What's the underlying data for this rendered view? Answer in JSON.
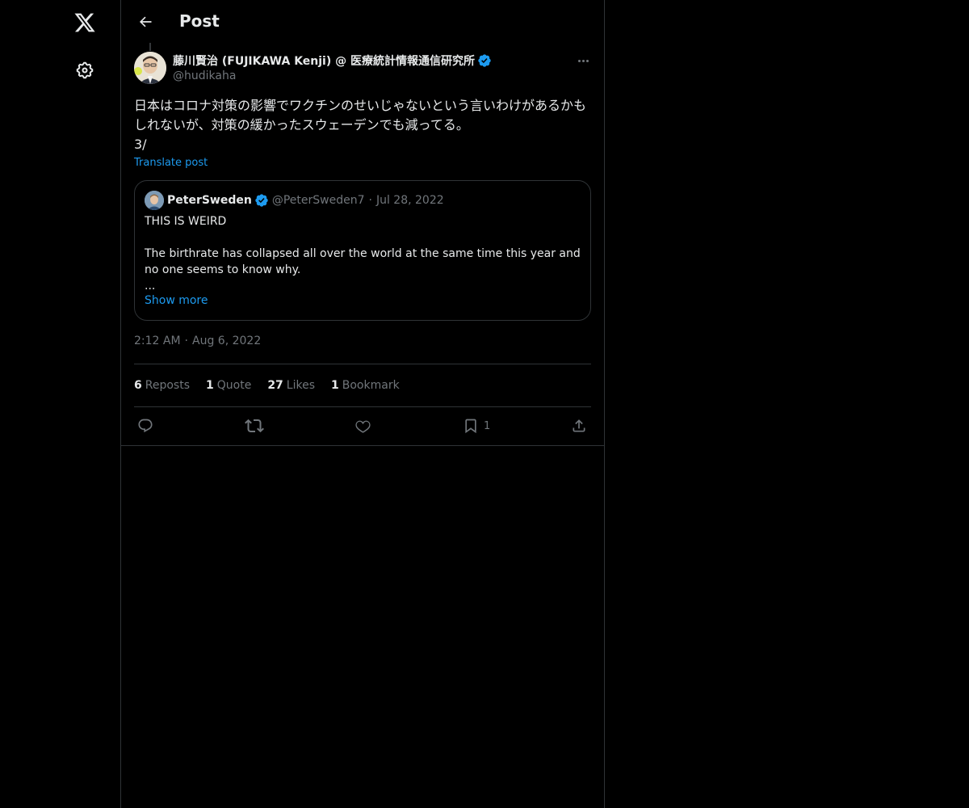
{
  "nav": {
    "logo_icon": "x-logo-icon",
    "settings_icon": "gear-icon"
  },
  "header": {
    "title": "Post",
    "back_icon": "arrow-left-icon"
  },
  "post": {
    "author_name": "藤川賢治 (FUJIKAWA Kenji) @ 医療統計情報通信研究所",
    "handle": "@hudikaha",
    "verified": true,
    "text": "日本はコロナ対策の影響でワクチンのせいじゃないという言いわけがあるかもしれないが、対策の緩かったスウェーデンでも減ってる。\n3/",
    "translate_label": "Translate post",
    "time": "2:12 AM",
    "date": "Aug 6, 2022"
  },
  "quote": {
    "name": "PeterSweden",
    "handle": "@PeterSweden7",
    "date": "Jul 28, 2022",
    "verified": true,
    "line1": "THIS IS WEIRD",
    "line2": "",
    "line3": "The birthrate has collapsed all over the world at the same time this year and no one seems to know why.",
    "line4": "...",
    "show_more": "Show more"
  },
  "stats": {
    "reposts_count": "6",
    "reposts_label": "Reposts",
    "quotes_count": "1",
    "quotes_label": "Quote",
    "likes_count": "27",
    "likes_label": "Likes",
    "bookmarks_count": "1",
    "bookmarks_label": "Bookmark"
  },
  "actions": {
    "reply_icon": "reply-icon",
    "repost_icon": "repost-icon",
    "like_icon": "heart-icon",
    "bookmark_icon": "bookmark-icon",
    "bookmark_count": "1",
    "share_icon": "share-icon"
  },
  "colors": {
    "accent": "#1d9bf0",
    "muted": "#71767b",
    "border": "#2f3336",
    "text": "#e7e9ea",
    "background": "#000000"
  }
}
